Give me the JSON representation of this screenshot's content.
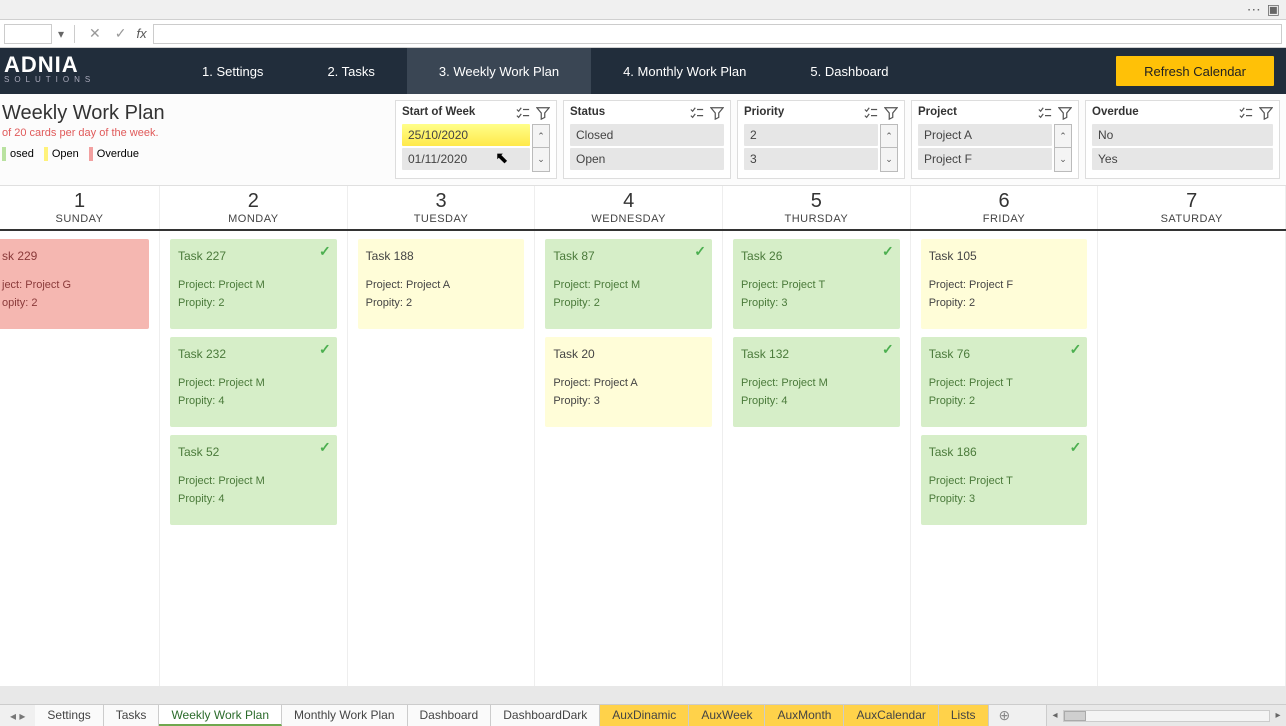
{
  "logo": {
    "main": "ADNIA",
    "sub": "SOLUTIONS"
  },
  "nav": {
    "settings": "1. Settings",
    "tasks": "2. Tasks",
    "weekly": "3. Weekly Work Plan",
    "monthly": "4. Monthly Work Plan",
    "dashboard": "5. Dashboard",
    "refresh": "Refresh Calendar"
  },
  "header": {
    "title": "Weekly Work Plan",
    "subtitle": "of 20 cards per day of the week."
  },
  "legend": {
    "closed": "osed",
    "open": "Open",
    "overdue": "Overdue"
  },
  "filters": {
    "start_label": "Start of Week",
    "start_items": [
      "25/10/2020",
      "01/11/2020"
    ],
    "status_label": "Status",
    "status_items": [
      "Closed",
      "Open"
    ],
    "priority_label": "Priority",
    "priority_items": [
      "2",
      "3"
    ],
    "project_label": "Project",
    "project_items": [
      "Project A",
      "Project F"
    ],
    "overdue_label": "Overdue",
    "overdue_items": [
      "No",
      "Yes"
    ]
  },
  "days": [
    {
      "num": "1",
      "name": "SUNDAY"
    },
    {
      "num": "2",
      "name": "MONDAY"
    },
    {
      "num": "3",
      "name": "TUESDAY"
    },
    {
      "num": "4",
      "name": "WEDNESDAY"
    },
    {
      "num": "5",
      "name": "THURSDAY"
    },
    {
      "num": "6",
      "name": "FRIDAY"
    },
    {
      "num": "7",
      "name": "SATURDAY"
    }
  ],
  "cards": {
    "sun": [
      {
        "title": "sk 229",
        "project": "ject: Project G",
        "priority": "opity: 2",
        "status": "overdue"
      }
    ],
    "mon": [
      {
        "title": "Task 227",
        "project": "Project: Project M",
        "priority": "Propity: 2",
        "status": "closed",
        "check": true
      },
      {
        "title": "Task 232",
        "project": "Project: Project M",
        "priority": "Propity: 4",
        "status": "closed",
        "check": true
      },
      {
        "title": "Task 52",
        "project": "Project: Project M",
        "priority": "Propity: 4",
        "status": "closed",
        "check": true
      }
    ],
    "tue": [
      {
        "title": "Task 188",
        "project": "Project: Project A",
        "priority": "Propity: 2",
        "status": "open"
      }
    ],
    "wed": [
      {
        "title": "Task 87",
        "project": "Project: Project M",
        "priority": "Propity: 2",
        "status": "closed",
        "check": true
      },
      {
        "title": "Task 20",
        "project": "Project: Project A",
        "priority": "Propity: 3",
        "status": "open"
      }
    ],
    "thu": [
      {
        "title": "Task 26",
        "project": "Project: Project T",
        "priority": "Propity: 3",
        "status": "closed",
        "check": true
      },
      {
        "title": "Task 132",
        "project": "Project: Project M",
        "priority": "Propity: 4",
        "status": "closed",
        "check": true
      }
    ],
    "fri": [
      {
        "title": "Task 105",
        "project": "Project: Project F",
        "priority": "Propity: 2",
        "status": "open"
      },
      {
        "title": "Task 76",
        "project": "Project: Project T",
        "priority": "Propity: 2",
        "status": "closed",
        "check": true
      },
      {
        "title": "Task 186",
        "project": "Project: Project T",
        "priority": "Propity: 3",
        "status": "closed",
        "check": true
      }
    ],
    "sat": []
  },
  "tabs": {
    "items": [
      "Settings",
      "Tasks",
      "Weekly Work Plan",
      "Monthly Work Plan",
      "Dashboard",
      "DashboardDark",
      "AuxDinamic",
      "AuxWeek",
      "AuxMonth",
      "AuxCalendar",
      "Lists"
    ],
    "active": "Weekly Work Plan",
    "aux": [
      "AuxDinamic",
      "AuxWeek",
      "AuxMonth",
      "AuxCalendar",
      "Lists"
    ]
  }
}
